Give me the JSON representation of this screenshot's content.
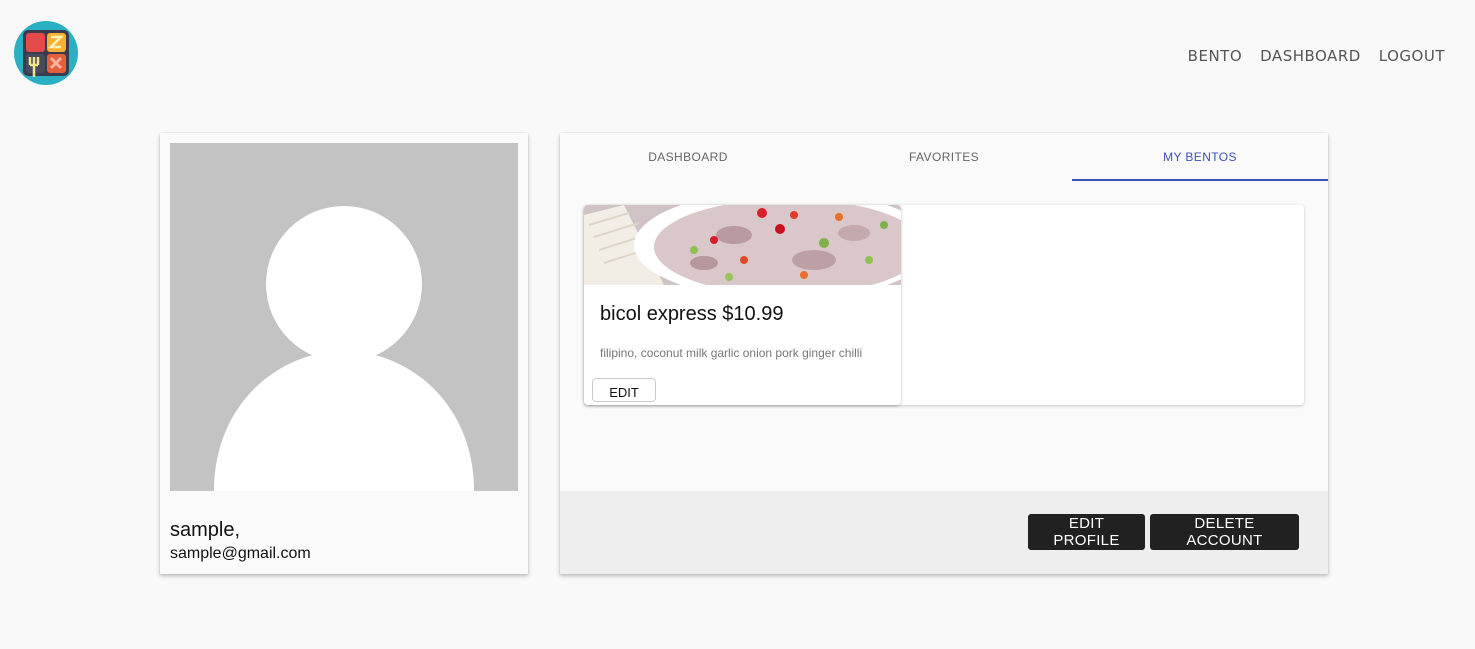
{
  "header": {
    "logo_icon": "bento-grid-logo",
    "nav": [
      "BENTO",
      "DASHBOARD",
      "LOGOUT"
    ]
  },
  "profile": {
    "avatar_icon": "default-user-silhouette",
    "name": "sample,",
    "email": "sample@gmail.com"
  },
  "main": {
    "tabs": [
      {
        "label": "DASHBOARD",
        "active": false
      },
      {
        "label": "FAVORITES",
        "active": false
      },
      {
        "label": "MY BENTOS",
        "active": true
      }
    ],
    "bentos": [
      {
        "title": "bicol express $10.99",
        "description": "filipino, coconut milk garlic onion pork ginger chilli",
        "edit_label": "EDIT"
      }
    ],
    "footer": {
      "edit_profile_label": "EDIT PROFILE",
      "delete_account_label": "DELETE ACCOUNT"
    }
  },
  "colors": {
    "accent": "#3f51b5",
    "button_dark": "#212121",
    "background": "#f9f9f9"
  }
}
